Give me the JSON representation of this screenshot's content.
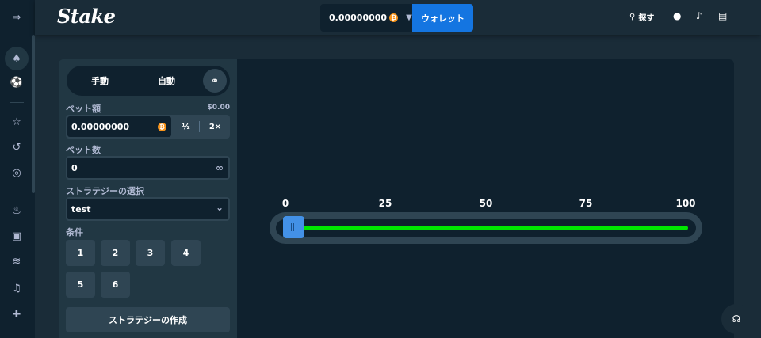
{
  "brand": {
    "logo": "Stake"
  },
  "header": {
    "balance": "0.00000000",
    "wallet_label": "ウォレット",
    "search_label": "探す"
  },
  "controls": {
    "tabs": {
      "manual": "手動",
      "auto": "自動"
    },
    "bet_amount_label": "ベット額",
    "bet_amount_fiat": "$0.00",
    "bet_amount_value": "0.00000000",
    "half_label": "½",
    "double_label": "2×",
    "bet_count_label": "ベット数",
    "bet_count_value": "0",
    "strategy_label": "ストラテジーの選択",
    "strategy_value": "test",
    "conditions_label": "条件",
    "conditions": [
      "1",
      "2",
      "3",
      "4",
      "5",
      "6"
    ],
    "create_strategy_label": "ストラテジーの作成"
  },
  "slider": {
    "ticks": [
      "0",
      "25",
      "50",
      "75",
      "100"
    ],
    "value": 0
  },
  "colors": {
    "accent": "#1475e1",
    "slider_fill": "#00e701",
    "handle": "#4391e7",
    "coin": "#f7931a"
  }
}
